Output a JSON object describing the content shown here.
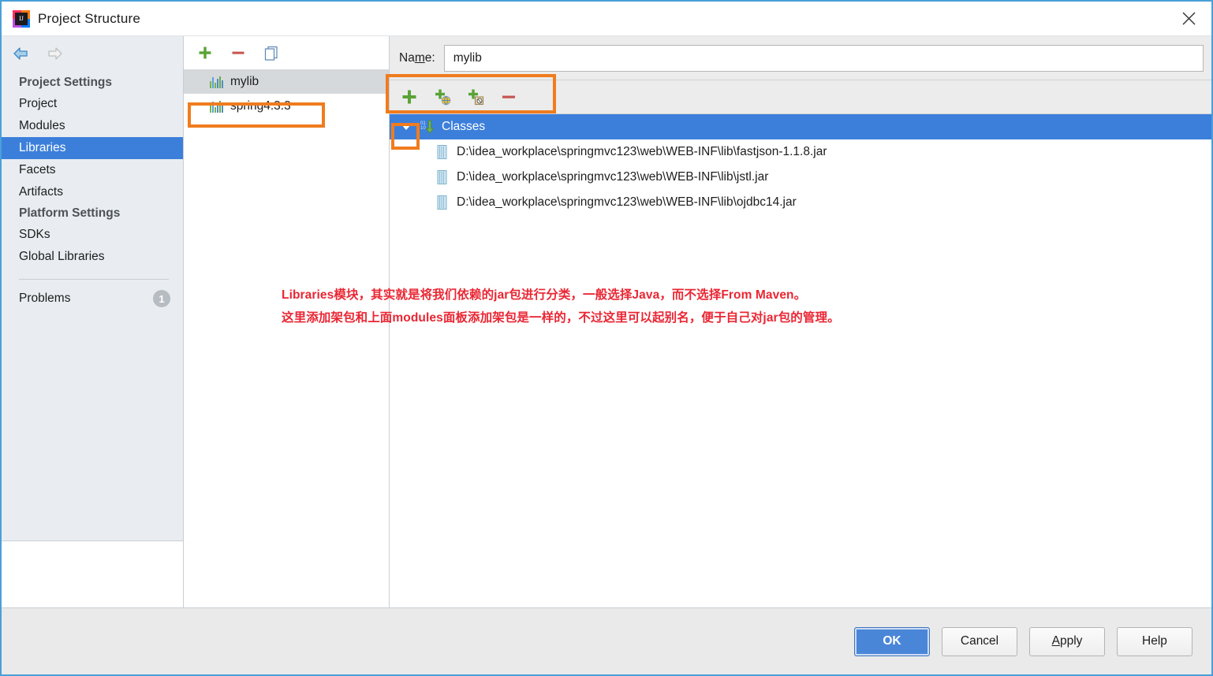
{
  "window": {
    "title": "Project Structure",
    "app_icon": "intellij-idea-icon",
    "close_icon": "close-icon"
  },
  "nav": {
    "back_icon": "arrow-left-icon",
    "forward_icon": "arrow-right-icon"
  },
  "sidebar": {
    "groups": [
      {
        "title": "Project Settings",
        "items": [
          {
            "label": "Project",
            "selected": false
          },
          {
            "label": "Modules",
            "selected": false
          },
          {
            "label": "Libraries",
            "selected": true
          },
          {
            "label": "Facets",
            "selected": false
          },
          {
            "label": "Artifacts",
            "selected": false
          }
        ]
      },
      {
        "title": "Platform Settings",
        "items": [
          {
            "label": "SDKs",
            "selected": false
          },
          {
            "label": "Global Libraries",
            "selected": false
          }
        ]
      }
    ],
    "problems": {
      "label": "Problems",
      "count": "1"
    }
  },
  "libraries_panel": {
    "toolbar": [
      {
        "name": "add-library-button",
        "icon": "plus-icon"
      },
      {
        "name": "remove-library-button",
        "icon": "minus-icon"
      },
      {
        "name": "copy-library-button",
        "icon": "copy-icon"
      }
    ],
    "items": [
      {
        "label": "mylib",
        "selected": true
      },
      {
        "label": "spring4.3.3",
        "selected": false
      }
    ]
  },
  "details_panel": {
    "name_label": "Name:",
    "name_label_mnemonic": "m",
    "name_value": "mylib",
    "name_placeholder": "",
    "toolbar": [
      {
        "name": "add-button",
        "icon": "plus-icon"
      },
      {
        "name": "add-url-button",
        "icon": "plus-globe-icon"
      },
      {
        "name": "attach-sources-button",
        "icon": "plus-package-icon"
      },
      {
        "name": "remove-button",
        "icon": "minus-icon"
      }
    ],
    "tree": {
      "root": {
        "label": "Classes",
        "icon": "classes-down-arrow-icon",
        "expanded": true
      },
      "children": [
        {
          "label": "D:\\idea_workplace\\springmvc123\\web\\WEB-INF\\lib\\fastjson-1.1.8.jar",
          "icon": "jar-file-icon"
        },
        {
          "label": "D:\\idea_workplace\\springmvc123\\web\\WEB-INF\\lib\\jstl.jar",
          "icon": "jar-file-icon"
        },
        {
          "label": "D:\\idea_workplace\\springmvc123\\web\\WEB-INF\\lib\\ojdbc14.jar",
          "icon": "jar-file-icon"
        }
      ]
    }
  },
  "annotation": {
    "line1": "Libraries模块，其实就是将我们依赖的jar包进行分类，一般选择Java，而不选择From Maven。",
    "line2": "这里添加架包和上面modules面板添加架包是一样的，不过这里可以起别名，便于自己对jar包的管理。",
    "color": "#ea2633"
  },
  "highlights": {
    "color": "#f07c1e",
    "boxes": [
      "mylib-library-row",
      "name-field",
      "add-button"
    ]
  },
  "footer": {
    "buttons": [
      {
        "label": "OK",
        "primary": true,
        "mnemonic": ""
      },
      {
        "label": "Cancel",
        "primary": false,
        "mnemonic": ""
      },
      {
        "label": "Apply",
        "primary": false,
        "mnemonic": "A"
      },
      {
        "label": "Help",
        "primary": false,
        "mnemonic": ""
      }
    ]
  },
  "colors": {
    "selection_blue": "#3c7fdb",
    "sidebar_bg": "#e9edf1",
    "footer_bg": "#eaeaea",
    "highlight_orange": "#f07c1e",
    "annotation_red": "#ea2633"
  }
}
